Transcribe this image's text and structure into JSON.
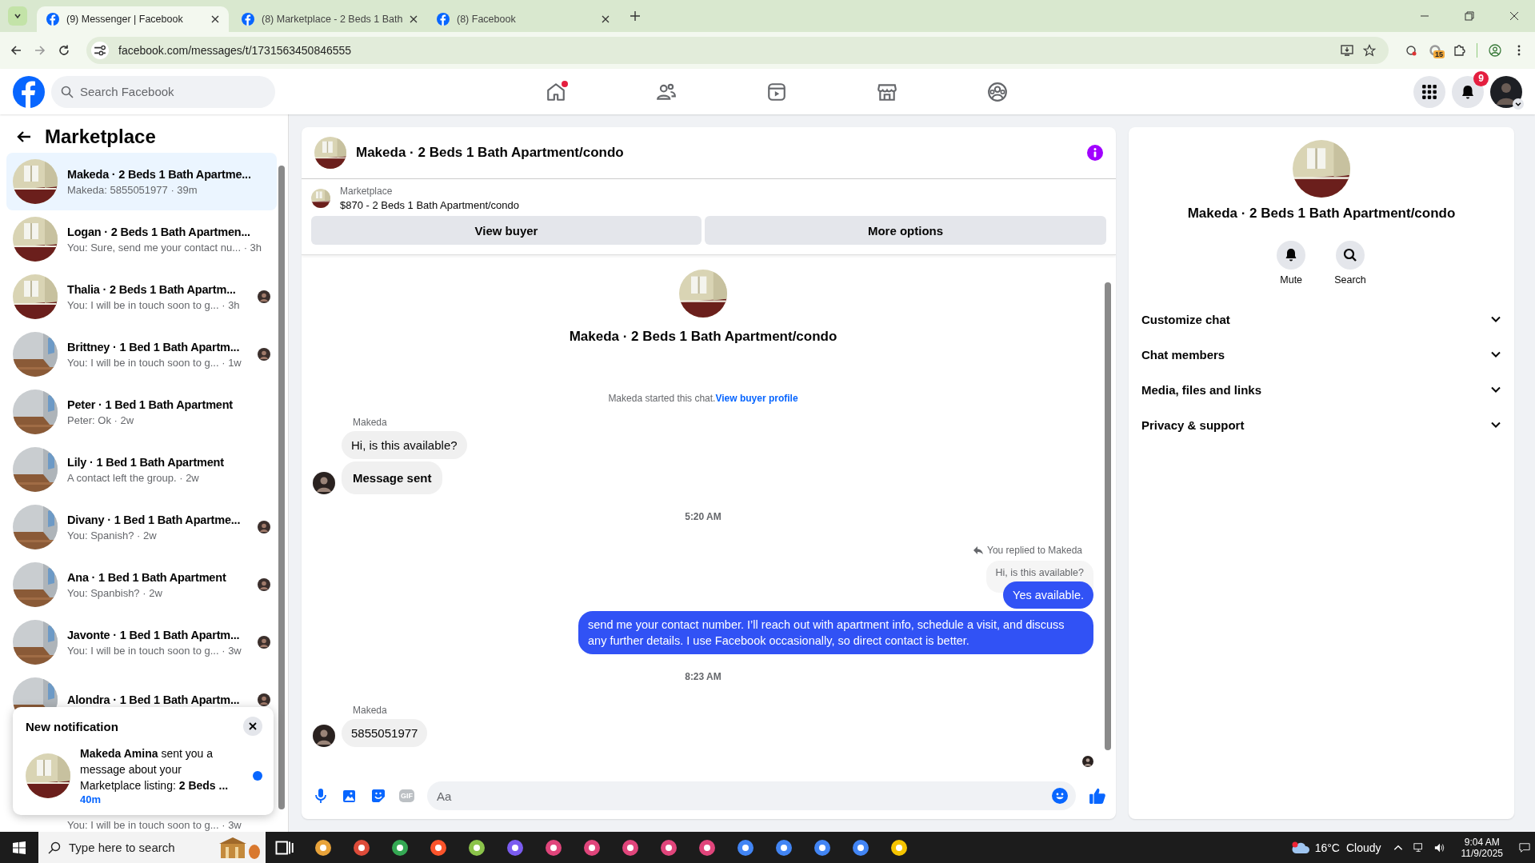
{
  "browser": {
    "tabs": [
      {
        "title": "(9) Messenger | Facebook",
        "selected": true
      },
      {
        "title": "(8) Marketplace - 2 Beds 1 Bath",
        "selected": false
      },
      {
        "title": "(8) Facebook",
        "selected": false
      }
    ],
    "url": "facebook.com/messages/t/1731563450846555",
    "extension_badge": "15"
  },
  "topbar": {
    "search_placeholder": "Search Facebook",
    "nav": [
      {
        "kind": "home",
        "dot": true
      },
      {
        "kind": "friends",
        "dot": false
      },
      {
        "kind": "video",
        "dot": false
      },
      {
        "kind": "marketplace",
        "dot": false
      },
      {
        "kind": "groups",
        "dot": false
      }
    ],
    "notification_count": "9"
  },
  "sidebar": {
    "title": "Marketplace",
    "conversations": [
      {
        "title": "Makeda · 2 Beds 1 Bath Apartme...",
        "preview": "Makeda: 5855051977 · 39m",
        "selected": true,
        "seen": false
      },
      {
        "title": "Logan · 2 Beds 1 Bath Apartmen...",
        "preview": "You: Sure, send me your contact nu... · 3h",
        "selected": false,
        "seen": false
      },
      {
        "title": "Thalia · 2 Beds 1 Bath Apartm...",
        "preview": "You: I will be in touch soon to g... · 3h",
        "selected": false,
        "seen": true
      },
      {
        "title": "Brittney · 1 Bed 1 Bath Apartm...",
        "preview": "You: I will be in touch soon to g... · 1w",
        "selected": false,
        "seen": true
      },
      {
        "title": "Peter · 1 Bed 1 Bath Apartment",
        "preview": "Peter: Ok · 2w",
        "selected": false,
        "seen": false
      },
      {
        "title": "Lily · 1 Bed 1 Bath Apartment",
        "preview": "A contact left the group. · 2w",
        "selected": false,
        "seen": false
      },
      {
        "title": "Divany · 1 Bed 1 Bath Apartme...",
        "preview": "You: Spanish? · 2w",
        "selected": false,
        "seen": true
      },
      {
        "title": "Ana · 1 Bed 1 Bath Apartment",
        "preview": "You: Spanbish? · 2w",
        "selected": false,
        "seen": true
      },
      {
        "title": "Javonte · 1 Bed 1 Bath Apartm...",
        "preview": "You: I will be in touch soon to g... · 3w",
        "selected": false,
        "seen": true
      },
      {
        "title": "Alondra · 1 Bed 1 Bath Apartm...",
        "selected": false,
        "seen": true
      },
      {
        "preview": "You: I will be in touch soon to g... · 3w",
        "selected": false
      }
    ]
  },
  "notification": {
    "title": "New notification",
    "text": "**Makeda Amina** sent you a message about your Marketplace listing: **2 Beds ...**",
    "time": "40m",
    "unread": true
  },
  "chat": {
    "title": "Makeda · 2 Beds 1 Bath Apartment/condo",
    "listing": {
      "label": "Marketplace",
      "text": "$870 - 2 Beds 1 Bath Apartment/condo"
    },
    "buttons": [
      "View buyer",
      "More options"
    ],
    "intro_title": "Makeda · 2 Beds 1 Bath Apartment/condo",
    "messages": [
      {
        "kind": "notice",
        "text": "Makeda started this chat.",
        "link": "View buyer profile"
      },
      {
        "kind": "sender",
        "text": "Makeda"
      },
      {
        "kind": "in",
        "text": "Hi, is this available?",
        "avatar": false,
        "strong": false
      },
      {
        "kind": "in",
        "text": "Message sent",
        "avatar": true,
        "strong": true
      },
      {
        "kind": "time",
        "text": "5:20 AM"
      },
      {
        "kind": "reply_label",
        "text": "You replied to Makeda"
      },
      {
        "kind": "quote",
        "text": "Hi, is this available?"
      },
      {
        "kind": "out",
        "text": "Yes available."
      },
      {
        "kind": "out",
        "text": "send me your contact number. I’ll reach out with apartment info, schedule a visit, and discuss any further details. I use Facebook occasionally, so direct contact is better."
      },
      {
        "kind": "time",
        "text": "8:23 AM"
      },
      {
        "kind": "sender",
        "text": "Makeda"
      },
      {
        "kind": "in",
        "text": "5855051977",
        "avatar": true,
        "strong": false
      },
      {
        "kind": "seen"
      }
    ],
    "composer": {
      "placeholder": "Aa",
      "gif": "GIF"
    }
  },
  "details": {
    "title": "Makeda · 2 Beds 1 Bath Apartment/condo",
    "actions": [
      {
        "kind": "mute",
        "label": "Mute"
      },
      {
        "kind": "search",
        "label": "Search"
      }
    ],
    "sections": [
      {
        "label": "Customize chat",
        "expanded": false
      },
      {
        "label": "Chat members",
        "expanded": false
      },
      {
        "label": "Media, files and links",
        "expanded": false
      },
      {
        "label": "Privacy & support",
        "expanded": false
      }
    ]
  },
  "taskbar": {
    "search_placeholder": "Type here to search",
    "temperature": "16°C",
    "weather": "Cloudy",
    "time": "9:04 AM",
    "date": "11/9/2025"
  }
}
